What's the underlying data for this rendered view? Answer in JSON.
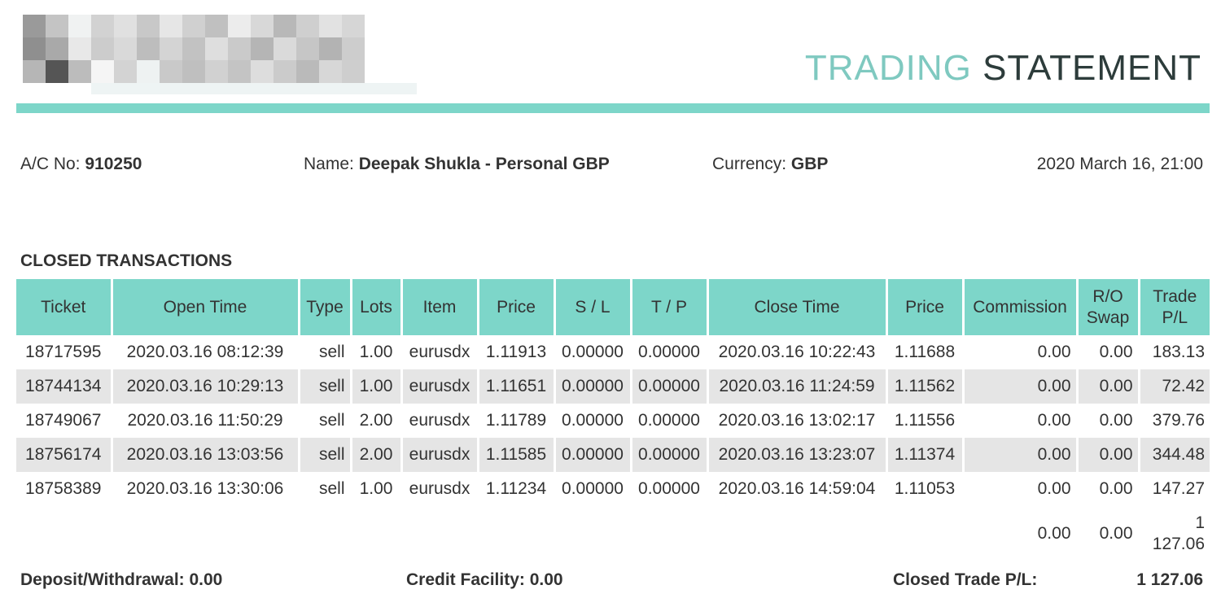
{
  "header": {
    "title_light": "TRADING",
    "title_dark": "STATEMENT",
    "accent_color": "#7dd6c9"
  },
  "account": {
    "ac_label": "A/C No:",
    "ac_value": "910250",
    "name_label": "Name:",
    "name_value": "Deepak Shukla - Personal GBP",
    "currency_label": "Currency:",
    "currency_value": "GBP",
    "date": "2020 March 16, 21:00"
  },
  "closed_transactions": {
    "heading": "CLOSED TRANSACTIONS",
    "columns": [
      "Ticket",
      "Open Time",
      "Type",
      "Lots",
      "Item",
      "Price",
      "S / L",
      "T / P",
      "Close Time",
      "Price",
      "Commission",
      "R/O Swap",
      "Trade P/L"
    ],
    "rows": [
      [
        "18717595",
        "2020.03.16 08:12:39",
        "sell",
        "1.00",
        "eurusdx",
        "1.11913",
        "0.00000",
        "0.00000",
        "2020.03.16 10:22:43",
        "1.11688",
        "0.00",
        "0.00",
        "183.13"
      ],
      [
        "18744134",
        "2020.03.16 10:29:13",
        "sell",
        "1.00",
        "eurusdx",
        "1.11651",
        "0.00000",
        "0.00000",
        "2020.03.16 11:24:59",
        "1.11562",
        "0.00",
        "0.00",
        "72.42"
      ],
      [
        "18749067",
        "2020.03.16 11:50:29",
        "sell",
        "2.00",
        "eurusdx",
        "1.11789",
        "0.00000",
        "0.00000",
        "2020.03.16 13:02:17",
        "1.11556",
        "0.00",
        "0.00",
        "379.76"
      ],
      [
        "18756174",
        "2020.03.16 13:03:56",
        "sell",
        "2.00",
        "eurusdx",
        "1.11585",
        "0.00000",
        "0.00000",
        "2020.03.16 13:23:07",
        "1.11374",
        "0.00",
        "0.00",
        "344.48"
      ],
      [
        "18758389",
        "2020.03.16 13:30:06",
        "sell",
        "1.00",
        "eurusdx",
        "1.11234",
        "0.00000",
        "0.00000",
        "2020.03.16 14:59:04",
        "1.11053",
        "0.00",
        "0.00",
        "147.27"
      ]
    ],
    "totals": {
      "commission": "0.00",
      "swap": "0.00",
      "trade_pl": "1 127.06"
    }
  },
  "summary": {
    "deposit_withdrawal": "Deposit/Withdrawal: 0.00",
    "credit_facility": "Credit Facility: 0.00",
    "closed_trade_pl_label": "Closed Trade P/L:",
    "closed_trade_pl_value": "1 127.06"
  }
}
